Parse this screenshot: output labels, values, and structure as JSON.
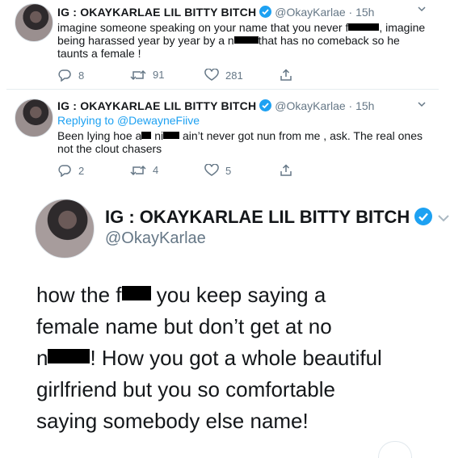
{
  "tweets": [
    {
      "name": "IG : OKAYKARLAE LIL BITTY BITCH",
      "handle": "@OkayKarlae",
      "separator": "·",
      "time": "15h",
      "text_parts": [
        "imagine someone speaking on your name that you never f",
        ", imagine being harassed year by year by a n",
        "that has no comeback so he taunts a female !"
      ],
      "replies": "8",
      "retweets": "91",
      "likes": "281"
    },
    {
      "name": "IG : OKAYKARLAE LIL BITTY BITCH",
      "handle": "@OkayKarlae",
      "separator": "·",
      "time": "15h",
      "replying_prefix": "Replying to ",
      "replying_to": "@DewayneFiive",
      "text_parts": [
        "Been lying hoe a",
        " ni",
        " ain’t never got nun from me , ask. The real ones not the clout chasers"
      ],
      "replies": "2",
      "retweets": "4",
      "likes": "5"
    }
  ],
  "zoomed": {
    "name": "IG : OKAYKARLAE LIL BITTY BITCH",
    "handle": "@OkayKarlae",
    "line1a": "how the f",
    "line1b": " you keep saying a",
    "line2": "female name but don’t get at no",
    "line3a": "n",
    "line3b": "! How you got a whole beautiful",
    "line4": "girlfriend but you so comfortable",
    "line5": "saying somebody else name!"
  },
  "colors": {
    "accent": "#1da1f2",
    "muted": "#657786",
    "text": "#14171a"
  }
}
